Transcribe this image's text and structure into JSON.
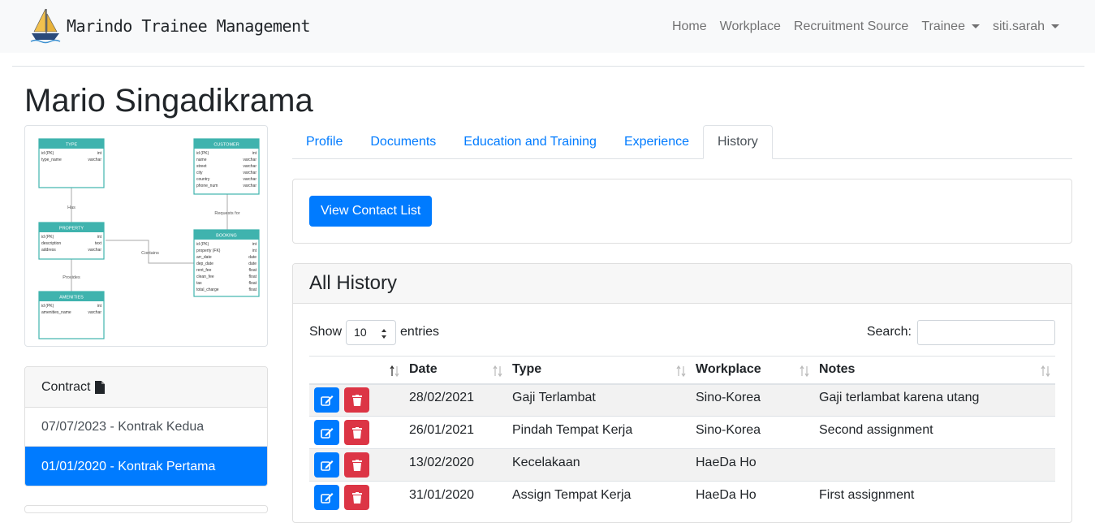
{
  "navbar": {
    "brand": "Marindo Trainee Management",
    "links": [
      {
        "label": "Home",
        "dropdown": false
      },
      {
        "label": "Workplace",
        "dropdown": false
      },
      {
        "label": "Recruitment Source",
        "dropdown": false
      },
      {
        "label": "Trainee",
        "dropdown": true
      },
      {
        "label": "siti.sarah",
        "dropdown": true
      }
    ]
  },
  "page_title": "Mario Singadikrama",
  "erd": {
    "type": {
      "title": "TYPE",
      "rows": [
        [
          "id (PK)",
          "int"
        ],
        [
          "type_name",
          "varchar"
        ]
      ]
    },
    "customer": {
      "title": "CUSTOMER",
      "rows": [
        [
          "id (PK)",
          "int"
        ],
        [
          "name",
          "varchar"
        ],
        [
          "street",
          "varchar"
        ],
        [
          "city",
          "varchar"
        ],
        [
          "country",
          "varchar"
        ],
        [
          "phone_num",
          "varchar"
        ]
      ]
    },
    "property": {
      "title": "PROPERTY",
      "rows": [
        [
          "id (PK)",
          "int"
        ],
        [
          "description",
          "text"
        ],
        [
          "address",
          "varchar"
        ]
      ]
    },
    "booking": {
      "title": "BOOKING",
      "rows": [
        [
          "id (PK)",
          "int"
        ],
        [
          "property (FK)",
          "int"
        ],
        [
          "arr_date",
          "date"
        ],
        [
          "dep_date",
          "date"
        ],
        [
          "rent_fee",
          "float"
        ],
        [
          "clean_fee",
          "float"
        ],
        [
          "tax",
          "float"
        ],
        [
          "total_charge",
          "float"
        ]
      ]
    },
    "amenities": {
      "title": "AMENITIES",
      "rows": [
        [
          "id (PK)",
          "int"
        ],
        [
          "amenities_name",
          "varchar"
        ]
      ]
    },
    "rel_has": "Has",
    "rel_requests": "Requests for",
    "rel_contains": "Contains",
    "rel_provides": "Provides"
  },
  "contract": {
    "title": "Contract",
    "items": [
      {
        "label": "07/07/2023 - Kontrak Kedua",
        "active": false
      },
      {
        "label": "01/01/2020 - Kontrak Pertama",
        "active": true
      }
    ]
  },
  "tabs": [
    {
      "label": "Profile",
      "active": false
    },
    {
      "label": "Documents",
      "active": false
    },
    {
      "label": "Education and Training",
      "active": false
    },
    {
      "label": "Experience",
      "active": false
    },
    {
      "label": "History",
      "active": true
    }
  ],
  "view_contact_button": "View Contact List",
  "history": {
    "title": "All History",
    "show_label": "Show",
    "entries_value": "10",
    "entries_label": "entries",
    "search_label": "Search:",
    "columns": [
      "",
      "Date",
      "Type",
      "Workplace",
      "Notes"
    ],
    "rows": [
      {
        "date": "28/02/2021",
        "type": "Gaji Terlambat",
        "workplace": "Sino-Korea",
        "notes": "Gaji terlambat karena utang"
      },
      {
        "date": "26/01/2021",
        "type": "Pindah Tempat Kerja",
        "workplace": "Sino-Korea",
        "notes": "Second assignment"
      },
      {
        "date": "13/02/2020",
        "type": "Kecelakaan",
        "workplace": "HaeDa Ho",
        "notes": ""
      },
      {
        "date": "31/01/2020",
        "type": "Assign Tempat Kerja",
        "workplace": "HaeDa Ho",
        "notes": "First assignment"
      }
    ]
  },
  "colors": {
    "primary": "#007bff",
    "danger": "#dc3545",
    "erd_teal": "#3fb3ae"
  }
}
